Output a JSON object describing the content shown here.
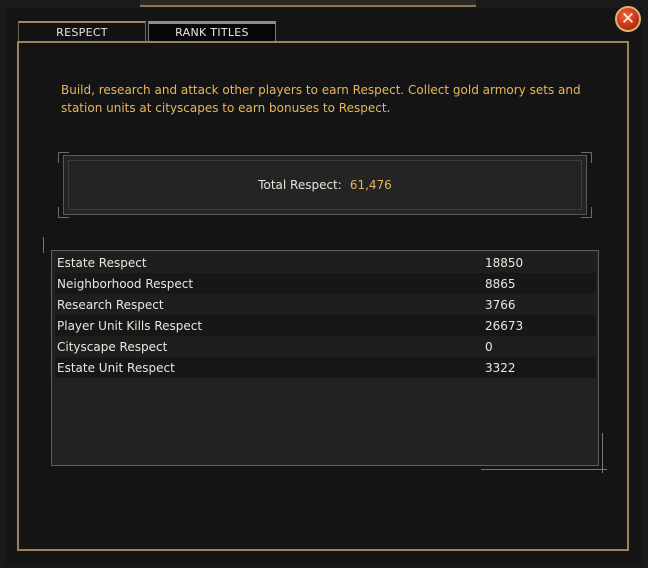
{
  "tabs": [
    {
      "label": "RESPECT",
      "active": true
    },
    {
      "label": "RANK TITLES",
      "active": false
    }
  ],
  "close_icon": "x-close-icon",
  "intro_text": "Build, research and attack other players to earn Respect. Collect gold armory sets and station units at cityscapes to earn bonuses to Respect.",
  "total": {
    "label": "Total Respect:",
    "value": "61,476"
  },
  "rows": [
    {
      "name": "Estate Respect",
      "value": "18850"
    },
    {
      "name": "Neighborhood Respect",
      "value": "8865"
    },
    {
      "name": "Research Respect",
      "value": "3766"
    },
    {
      "name": "Player Unit Kills Respect",
      "value": "26673"
    },
    {
      "name": "Cityscape Respect",
      "value": "0"
    },
    {
      "name": "Estate Unit Respect",
      "value": "3322"
    }
  ],
  "colors": {
    "accent_gold": "#e6b35a",
    "frame_gold": "#9b825c",
    "close_red": "#c7341b"
  }
}
